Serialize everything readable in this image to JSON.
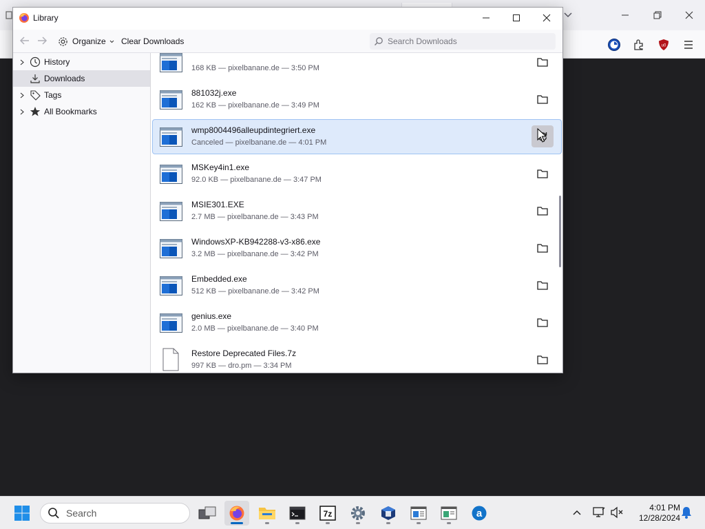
{
  "library": {
    "title": "Library",
    "organize_label": "Organize",
    "clear_downloads_label": "Clear Downloads",
    "search_placeholder": "Search Downloads"
  },
  "sidebar": {
    "items": [
      {
        "label": "History",
        "icon": "clock-icon",
        "expandable": true,
        "selected": false
      },
      {
        "label": "Downloads",
        "icon": "download-icon",
        "expandable": false,
        "selected": true
      },
      {
        "label": "Tags",
        "icon": "tag-icon",
        "expandable": true,
        "selected": false
      },
      {
        "label": "All Bookmarks",
        "icon": "star-icon",
        "expandable": true,
        "selected": false
      }
    ]
  },
  "downloads": [
    {
      "name": "",
      "status": "168 KB — pixelbanane.de — 3:50 PM",
      "icon": "exe-file-icon",
      "action": "folder-icon"
    },
    {
      "name": "881032j.exe",
      "status": "162 KB — pixelbanane.de — 3:49 PM",
      "icon": "exe-file-icon",
      "action": "folder-icon"
    },
    {
      "name": "wmp8004496alleupdintegriert.exe",
      "status": "Canceled — pixelbanane.de — 4:01 PM",
      "icon": "exe-file-icon",
      "action": "retry-icon"
    },
    {
      "name": "MSKey4in1.exe",
      "status": "92.0 KB — pixelbanane.de — 3:47 PM",
      "icon": "exe-file-icon",
      "action": "folder-icon"
    },
    {
      "name": "MSIE301.EXE",
      "status": "2.7 MB — pixelbanane.de — 3:43 PM",
      "icon": "exe-file-icon",
      "action": "folder-icon"
    },
    {
      "name": "WindowsXP-KB942288-v3-x86.exe",
      "status": "3.2 MB — pixelbanane.de — 3:42 PM",
      "icon": "exe-file-icon",
      "action": "folder-icon"
    },
    {
      "name": "Embedded.exe",
      "status": "512 KB — pixelbanane.de — 3:42 PM",
      "icon": "exe-file-icon",
      "action": "folder-icon"
    },
    {
      "name": "genius.exe",
      "status": "2.0 MB — pixelbanane.de — 3:40 PM",
      "icon": "exe-file-icon",
      "action": "folder-icon"
    },
    {
      "name": "Restore Deprecated Files.7z",
      "status": "997 KB — dro.pm — 3:34 PM",
      "icon": "generic-file-icon",
      "action": "folder-icon"
    }
  ],
  "taskbar": {
    "search_placeholder": "Search",
    "apps": [
      "start-icon",
      "task-view-icon",
      "firefox-icon",
      "file-explorer-icon",
      "terminal-icon",
      "7zip-icon",
      "settings-icon",
      "vm-icon",
      "notepad-icon",
      "photo-viewer-icon",
      "edge-icon"
    ],
    "time": "4:01 PM",
    "date": "12/28/2024"
  },
  "colors": {
    "selection_bg": "#deeafb",
    "selection_border": "#9ec2f3",
    "accent": "#0067c0"
  }
}
